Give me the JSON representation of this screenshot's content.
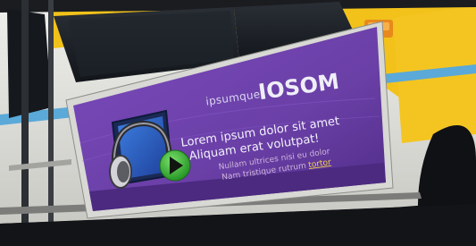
{
  "scene": {
    "subject": "city bus side panel with advertisement",
    "colors": {
      "bus_yellow": "#f2c21a",
      "bus_white": "#e8e8e4",
      "stripe_blue": "#5aa9d8",
      "ad_purple": "#6a3fa6",
      "ad_purple_dark": "#4b2a80",
      "play_green": "#3bbf3a",
      "link_yellow": "#f0d24a"
    }
  },
  "ad": {
    "brand_small": "ipsumque",
    "brand_logo": "IOSOM",
    "headline_line1": "Lorem ipsum dolor sit amet",
    "headline_line2": "Aliquam erat volutpat!",
    "body_line1": "Nullam ultrices nisi eu dolor",
    "body_line2": "Nam tristique rutrum",
    "link_text": "tortor",
    "icons": [
      "headphones-icon",
      "play-icon"
    ]
  }
}
